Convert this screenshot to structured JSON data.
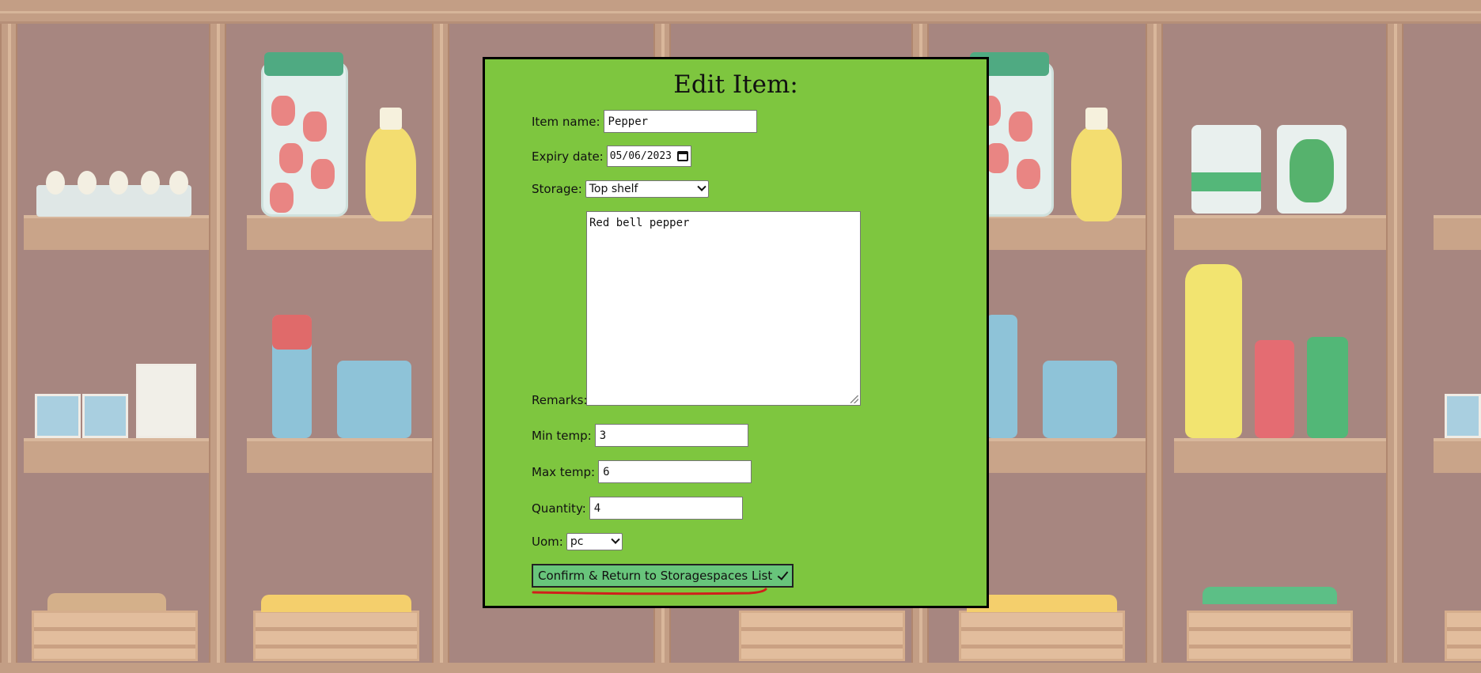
{
  "form": {
    "title": "Edit Item:",
    "item_name": {
      "label": "Item name:",
      "value": "Pepper"
    },
    "expiry_date": {
      "label": "Expiry date:",
      "value": "05/06/2023"
    },
    "storage": {
      "label": "Storage:",
      "selected": "Top shelf"
    },
    "remarks": {
      "label": "Remarks:",
      "value": "Red bell pepper"
    },
    "min_temp": {
      "label": "Min temp:",
      "value": "3"
    },
    "max_temp": {
      "label": "Max temp:",
      "value": "6"
    },
    "quantity": {
      "label": "Quantity:",
      "value": "4"
    },
    "uom": {
      "label": "Uom:",
      "selected": "pc"
    },
    "confirm_button": "Confirm & Return to Storagespaces List"
  },
  "colors": {
    "modal_bg": "#7ec63f",
    "button_bg": "#68c57b",
    "annotation_underline": "#d0201b"
  },
  "icons": [
    "calendar-icon",
    "chevron-down-icon",
    "check-icon",
    "resize-handle-icon"
  ]
}
